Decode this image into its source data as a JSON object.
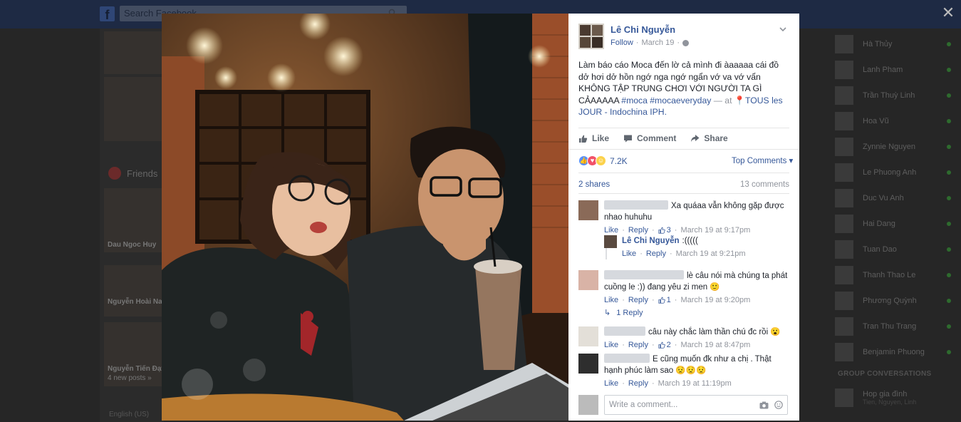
{
  "background": {
    "search_placeholder": "Search Facebook",
    "friends_label": "Friends",
    "left_labels": [
      "Dau Ngoc Huy",
      "Nguyễn Hoài Nam",
      "Nguyễn Tiến Đạt",
      "4 new posts »"
    ],
    "language": "English (US)"
  },
  "chat": {
    "contacts": [
      "Hà Thủy",
      "Lanh Pham",
      "Trần Thuỳ Linh",
      "Hoa Vũ",
      "Zynnie Nguyen",
      "Le Phuong Anh",
      "Duc Vu Anh",
      "Hai Dang",
      "Tuan Dao",
      "Thanh Thao Le",
      "Phương Quỳnh",
      "Tran Thu Trang",
      "Benjamin Phuong"
    ],
    "group_heading": "GROUP CONVERSATIONS",
    "group_name": "Hop gia đình",
    "group_members": "Tien, Nguyen, Linh",
    "online_color": "#2e6b2e"
  },
  "post": {
    "author": "Lê Chi Nguyễn",
    "follow": "Follow",
    "date": "March 19",
    "text_main": "Làm báo cáo Moca đến lờ cả mình đi àaaaaa cái đồ dở hơi dở hồn ngớ nga ngớ ngẩn vớ va vớ vẩn KHÔNG TẬP TRUNG CHƠI VỚI NGƯỜI TA GÌ CẢAAAAA",
    "hashtag1": "#moca",
    "hashtag2": "#mocaeveryday",
    "at_text": "— at",
    "place": "TOUS les JOUR - Indochina IPH.",
    "like_label": "Like",
    "comment_label": "Comment",
    "share_label": "Share",
    "reaction_count": "7.2K",
    "top_comments": "Top Comments",
    "shares": "2 shares",
    "comments_count": "13 comments",
    "accent": "#365899"
  },
  "comments": [
    {
      "text": "Xa quáaa vẫn không gặp được nhao huhuhu",
      "like": "Like",
      "reply": "Reply",
      "likes": "3",
      "time": "March 19 at 9:17pm"
    },
    {
      "author": "Lê Chi Nguyễn",
      "text": ":(((((",
      "like": "Like",
      "reply": "Reply",
      "time": "March 19 at 9:21pm"
    },
    {
      "text": "lè câu nói mà chúng ta phát cuồng le :)) đang yêu zi men 🙂",
      "like": "Like",
      "reply": "Reply",
      "likes": "1",
      "time": "March 19 at 9:20pm",
      "replies": "1 Reply"
    },
    {
      "text": "câu này chắc làm thần chú đc rồi 😮",
      "like": "Like",
      "reply": "Reply",
      "likes": "2",
      "time": "March 19 at 8:47pm"
    },
    {
      "text": "E cũng muốn đk như a chị . Thật hạnh phúc làm sao 😟😟😟",
      "like": "Like",
      "reply": "Reply",
      "time": "March 19 at 11:19pm"
    }
  ],
  "composer": {
    "placeholder": "Write a comment..."
  }
}
